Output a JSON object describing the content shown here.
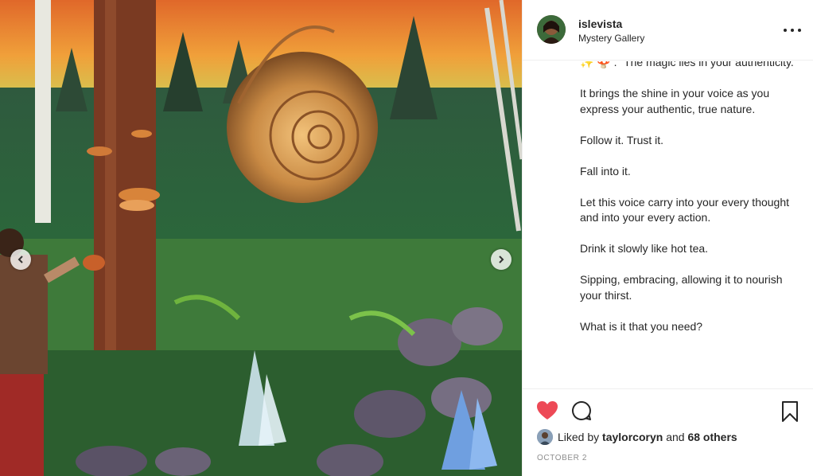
{
  "post": {
    "username": "islevista",
    "location": "Mystery Gallery",
    "more_icon": "more-horizontal-icon"
  },
  "media": {
    "description_icon": "mural-image",
    "prev_icon": "chevron-left-icon",
    "next_icon": "chevron-right-icon"
  },
  "caption": {
    "first_line_rest": ". “The magic lies in your authenticity.",
    "paragraphs": [
      "It brings the shine in your voice as you express your authentic, true nature.",
      "Follow it. Trust it.",
      "Fall into it.",
      "Let this voice carry into your every thought and into your every action.",
      "Drink it slowly like hot tea.",
      "Sipping, embracing, allowing it to nourish your thirst.",
      "What is it that you need?"
    ]
  },
  "actions": {
    "like_icon": "heart-filled-icon",
    "comment_icon": "comment-bubble-icon",
    "save_icon": "bookmark-icon",
    "like_color": "#ed4956"
  },
  "likes": {
    "prefix": "Liked by",
    "user": "taylorcoryn",
    "conjunction": "and",
    "others": "68 others"
  },
  "date": "OCTOBER 2"
}
